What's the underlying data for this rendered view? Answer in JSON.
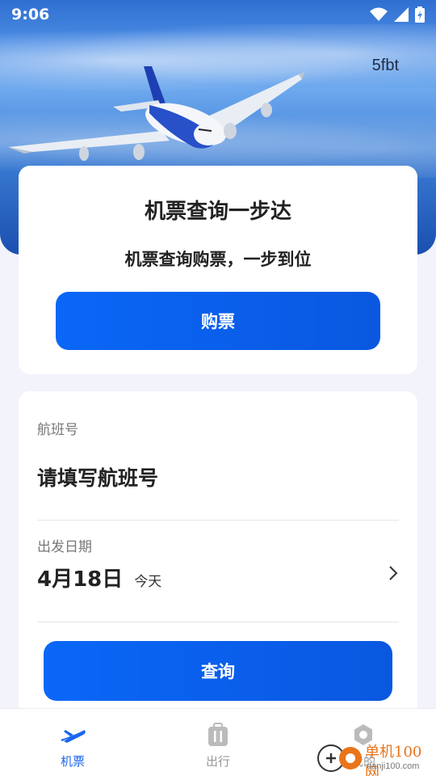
{
  "status_bar": {
    "time": "9:06"
  },
  "header": {
    "brand_tag": "5fbt"
  },
  "hero_card": {
    "title": "机票查询一步达",
    "subtitle": "机票查询购票，一步到位",
    "buy_button": "购票"
  },
  "query_card": {
    "flight_label": "航班号",
    "flight_placeholder": "请填写航班号",
    "date_label": "出发日期",
    "date_value": "4月18日",
    "date_day": "今天",
    "query_button": "查询"
  },
  "bottom_nav": {
    "items": [
      {
        "label": "机票",
        "icon": "airplane-icon",
        "active": true
      },
      {
        "label": "出行",
        "icon": "suitcase-icon",
        "active": false
      },
      {
        "label": "我的",
        "icon": "profile-icon",
        "active": false
      }
    ]
  },
  "watermark": {
    "text": "单机100网",
    "url": "danji100.com"
  },
  "colors": {
    "accent": "#0a63f2",
    "background": "#f2f3fb"
  }
}
